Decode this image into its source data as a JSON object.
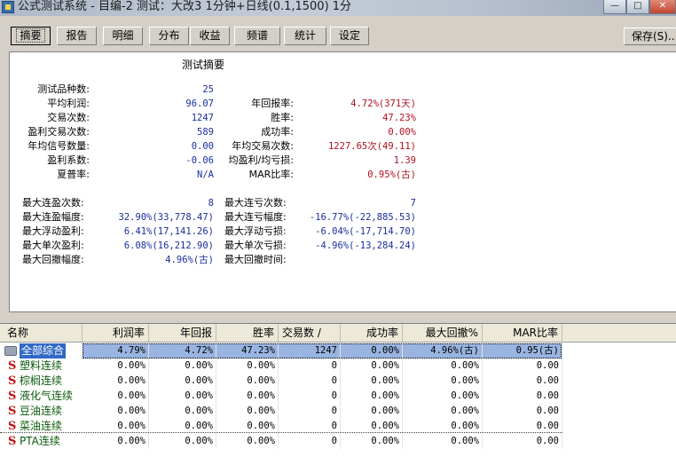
{
  "window": {
    "title": "公式测试系统 - 目编-2 测试：大改3 1分钟+日线(0.1,1500) 1分",
    "min_label": "—",
    "max_label": "□",
    "close_label": "✕"
  },
  "tabs": [
    {
      "label": "摘要",
      "active": true
    },
    {
      "label": "报告"
    },
    {
      "label": "明细"
    },
    {
      "label": "分布"
    },
    {
      "label": "收益"
    },
    {
      "label": "频谱"
    },
    {
      "label": "统计"
    },
    {
      "label": "设定"
    }
  ],
  "save_label": "保存(S)...",
  "summary": {
    "title": "测试摘要",
    "left_rows": [
      {
        "label": "测试品种数:",
        "value": "25"
      },
      {
        "label": "平均利润:",
        "value": "96.07"
      },
      {
        "label": "交易次数:",
        "value": "1247"
      },
      {
        "label": "盈利交易次数:",
        "value": "589"
      },
      {
        "label": "年均信号数量:",
        "value": "0.00"
      },
      {
        "label": "盈利系数:",
        "value": "-0.06"
      },
      {
        "label": "夏普率:",
        "value": "N/A"
      }
    ],
    "right_rows": [
      {
        "label": "年回报率:",
        "value": "4.72%(371天)"
      },
      {
        "label": "胜率:",
        "value": "47.23%"
      },
      {
        "label": "成功率:",
        "value": "0.00%"
      },
      {
        "label": "年均交易次数:",
        "value": "1227.65次(49.11)"
      },
      {
        "label": "均盈利/均亏损:",
        "value": "1.39"
      },
      {
        "label": "MAR比率:",
        "value": "0.95%(古)"
      }
    ],
    "left_rows2": [
      {
        "label": "最大连盈次数:",
        "value": "8"
      },
      {
        "label": "最大连盈幅度:",
        "value": "32.90%(33,778.47)"
      },
      {
        "label": "最大浮动盈利:",
        "value": "6.41%(17,141.26)"
      },
      {
        "label": "最大单次盈利:",
        "value": "6.08%(16,212.90)"
      },
      {
        "label": "最大回撤幅度:",
        "value": "4.96%(古)"
      }
    ],
    "right_rows2": [
      {
        "label": "最大连亏次数:",
        "value": "7"
      },
      {
        "label": "最大连亏幅度:",
        "value": "-16.77%(-22,885.53)"
      },
      {
        "label": "最大浮动亏损:",
        "value": "-6.04%(-17,714.70)"
      },
      {
        "label": "最大单次亏损:",
        "value": "-4.96%(-13,284.24)"
      },
      {
        "label": "最大回撤时间:",
        "value": ""
      }
    ]
  },
  "table": {
    "headers": [
      "名称",
      "利润率",
      "年回报",
      "胜率",
      "交易数 /",
      "成功率",
      "最大回撤%",
      "MAR比率"
    ],
    "rows": [
      {
        "name": "全部综合",
        "cells": [
          "4.79%",
          "4.72%",
          "47.23%",
          "1247",
          "0.00%",
          "4.96%(古)",
          "0.95(古)"
        ],
        "selected": true
      },
      {
        "name": "塑料连续",
        "cells": [
          "0.00%",
          "0.00%",
          "0.00%",
          "0",
          "0.00%",
          "0.00%",
          "0.00"
        ]
      },
      {
        "name": "棕榈连续",
        "cells": [
          "0.00%",
          "0.00%",
          "0.00%",
          "0",
          "0.00%",
          "0.00%",
          "0.00"
        ]
      },
      {
        "name": "液化气连续",
        "cells": [
          "0.00%",
          "0.00%",
          "0.00%",
          "0",
          "0.00%",
          "0.00%",
          "0.00"
        ]
      },
      {
        "name": "豆油连续",
        "cells": [
          "0.00%",
          "0.00%",
          "0.00%",
          "0",
          "0.00%",
          "0.00%",
          "0.00"
        ]
      },
      {
        "name": "菜油连续",
        "cells": [
          "0.00%",
          "0.00%",
          "0.00%",
          "0",
          "0.00%",
          "0.00%",
          "0.00"
        ]
      },
      {
        "name": "PTA连续",
        "cells": [
          "0.00%",
          "0.00%",
          "0.00%",
          "0",
          "0.00%",
          "0.00%",
          "0.00"
        ]
      }
    ]
  },
  "colors": {
    "value_blue": "#1a2e9a",
    "value_red": "#b01020",
    "selection": "#316ac5"
  }
}
